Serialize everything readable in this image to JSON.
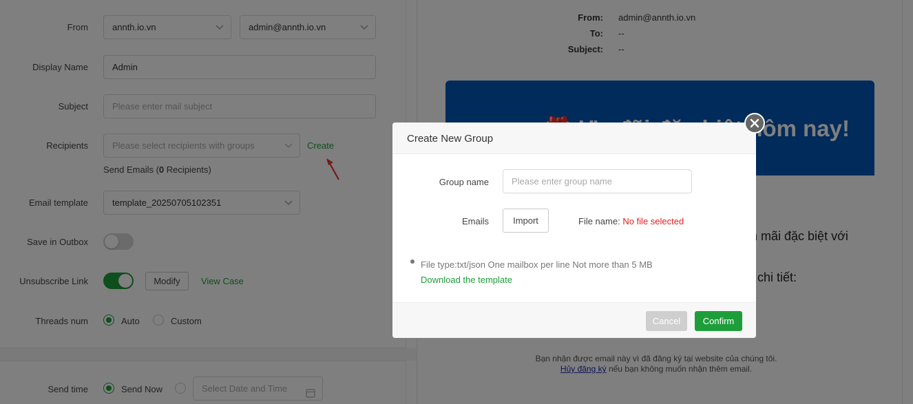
{
  "form": {
    "from_label": "From",
    "from_domain": "annth.io.vn",
    "from_email": "admin@annth.io.vn",
    "display_name_label": "Display Name",
    "display_name_value": "Admin",
    "subject_label": "Subject",
    "subject_placeholder": "Please enter mail subject",
    "recipients_label": "Recipients",
    "recipients_placeholder": "Please select recipients with groups",
    "create_link": "Create",
    "send_emails_prefix": "Send Emails (",
    "send_emails_count": "0",
    "send_emails_suffix": " Recipients)",
    "email_template_label": "Email template",
    "email_template_value": "template_20250705102351",
    "save_outbox_label": "Save in Outbox",
    "unsubscribe_label": "Unsubscribe Link",
    "modify_button": "Modify",
    "view_case_link": "View Case",
    "threads_label": "Threads num",
    "threads_auto": "Auto",
    "threads_custom": "Custom",
    "send_time_label": "Send time",
    "send_now": "Send Now",
    "datetime_placeholder": "Select Date and Time"
  },
  "preview": {
    "from_label": "From:",
    "from_value": "admin@annth.io.vn",
    "to_label": "To:",
    "to_value": "--",
    "subject_label": "Subject:",
    "subject_value": "--",
    "banner_text": "🎁 Ưu đãi đặc biệt hôm nay!",
    "body_line1": "ến mãi đặc biệt với",
    "body_line2": "chi tiết:",
    "footer_line1": "Bạn nhận được email này vì đã đăng ký tại website của chúng tôi.",
    "footer_link": "Hủy đăng ký",
    "footer_line2_rest": " nếu bạn không muốn nhận thêm email."
  },
  "modal": {
    "title": "Create New Group",
    "group_name_label": "Group name",
    "group_name_placeholder": "Please enter group name",
    "emails_label": "Emails",
    "import_button": "Import",
    "file_name_label": "File name:",
    "file_name_value": "No file selected",
    "file_type_hint": "File type:txt/json One mailbox per line Not more than 5 MB",
    "download_template": "Download the template",
    "cancel_button": "Cancel",
    "confirm_button": "Confirm"
  },
  "colors": {
    "accent_green": "#1e9e3a",
    "banner_blue": "#0057b7",
    "error_red": "#e02020",
    "arrow_red": "#e53935"
  },
  "toggles": {
    "save_in_outbox": false,
    "unsubscribe_link": true
  }
}
